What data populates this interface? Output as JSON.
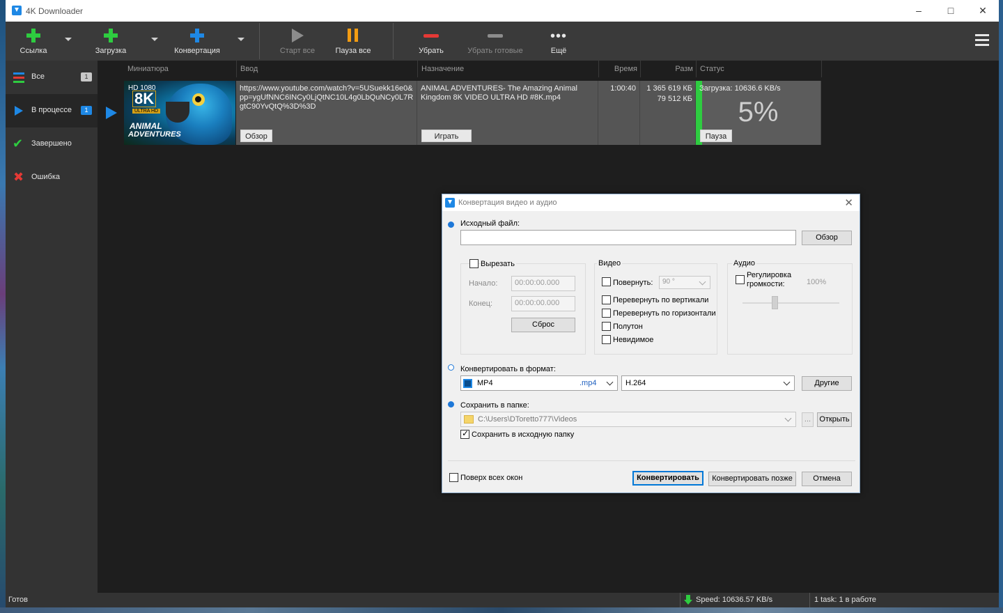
{
  "window": {
    "title": "4K Downloader"
  },
  "toolbar": {
    "link_label": "Ссылка",
    "download_label": "Загрузка",
    "convert_label": "Конвертация",
    "start_all_label": "Старт все",
    "pause_all_label": "Пауза все",
    "remove_label": "Убрать",
    "remove_done_label": "Убрать готовые",
    "more_label": "Ещё"
  },
  "sidebar": {
    "items": [
      {
        "label": "Все",
        "count": "1"
      },
      {
        "label": "В процессе",
        "count": "1"
      },
      {
        "label": "Завершено"
      },
      {
        "label": "Ошибка"
      }
    ]
  },
  "table": {
    "headers": [
      "Миниатюра",
      "Ввод",
      "Назначение",
      "Время",
      "Разм",
      "Статус"
    ],
    "row": {
      "thumb_badge_hd": "HD 1080",
      "thumb_badge_8k": "8K",
      "thumb_badge_ultra": "ULTRA HD",
      "thumb_title_1": "ANIMAL",
      "thumb_title_2": "ADVENTURES",
      "input_url": "https://www.youtube.com/watch?v=5USuekk16e0&pp=ygUfNNC6INCy0LjQtNC10L4g0LbQuNCy0L7RgtC90YvQtQ%3D%3D",
      "browse_label": "Обзор",
      "destination": "ANIMAL ADVENTURES- The Amazing Animal Kingdom 8K VIDEO ULTRA HD #8K.mp4",
      "play_label": "Играть",
      "time": "1:00:40",
      "size_total": "1 365 619 КБ",
      "size_done": "79 512 КБ",
      "status_text": "Загрузка: 10636.6 KB/s",
      "progress_text": "5%",
      "progress": 0.05,
      "pause_label": "Пауза"
    }
  },
  "statusbar": {
    "ready": "Готов",
    "speed": "Speed: 10636.57 KB/s",
    "tasks": "1 task: 1 в работе"
  },
  "dialog": {
    "title": "Конвертация видео и аудио",
    "source_label": "Исходный файл:",
    "source_value": "",
    "browse_label": "Обзор",
    "cut": {
      "label": "Вырезать",
      "start_label": "Начало:",
      "start_value": "00:00:00.000",
      "end_label": "Конец:",
      "end_value": "00:00:00.000",
      "reset_label": "Сброс"
    },
    "video": {
      "group_label": "Видео",
      "rotate_label": "Повернуть:",
      "rotate_value": "90 °",
      "flip_v_label": "Перевернуть по вертикали",
      "flip_h_label": "Перевернуть по горизонтали",
      "halftone_label": "Полутон",
      "invisible_label": "Невидимое"
    },
    "audio": {
      "group_label": "Аудио",
      "volume_label_1": "Регулировка",
      "volume_label_2": "громкости:",
      "volume_value": "100%"
    },
    "format": {
      "label": "Конвертировать в формат:",
      "container": "MP4",
      "extension": ".mp4",
      "codec": "H.264",
      "other_label": "Другие"
    },
    "save": {
      "label": "Сохранить в папке:",
      "path": "C:\\Users\\DToretto777\\Videos",
      "dots_label": "...",
      "open_label": "Открыть",
      "same_folder_label": "Сохранить в исходную папку"
    },
    "on_top_label": "Поверх всех окон",
    "convert_label": "Конвертировать",
    "convert_later_label": "Конвертировать позже",
    "cancel_label": "Отмена"
  },
  "colors": {
    "accent_green": "#2ecc40",
    "accent_blue": "#1e88e5",
    "accent_orange": "#f39c12",
    "accent_red": "#e53935",
    "progress_green": "#2ecc40"
  }
}
